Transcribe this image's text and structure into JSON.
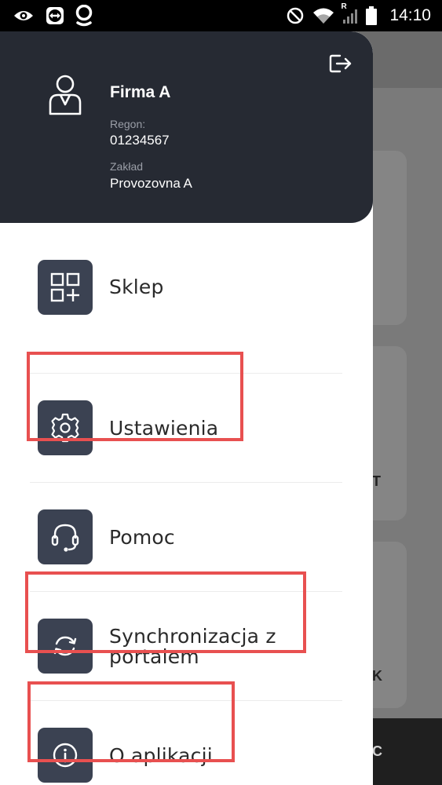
{
  "status_bar": {
    "time": "14:10",
    "left_icons": [
      "eye-icon",
      "teamviewer-icon",
      "location-pin-icon"
    ],
    "right_icons": [
      "do-not-disturb-icon",
      "wifi-icon",
      "signal-icon",
      "battery-icon"
    ],
    "roaming_indicator": "R"
  },
  "drawer": {
    "header": {
      "company_name": "Firma A",
      "regon_label": "Regon:",
      "regon_value": "01234567",
      "zaklad_label": "Zakład",
      "zaklad_value": "Provozovna A",
      "logout_icon": "logout-icon",
      "avatar_icon": "user-icon",
      "background_color": "#262a33"
    },
    "menu_items": [
      {
        "label": "Sklep",
        "icon": "grid-plus-icon",
        "highlighted": false
      },
      {
        "label": "Ustawienia",
        "icon": "gear-icon",
        "highlighted": true
      },
      {
        "label": "Pomoc",
        "icon": "headset-icon",
        "highlighted": false
      },
      {
        "label": "Synchronizacja z portalem",
        "icon": "sync-icon",
        "highlighted": true
      },
      {
        "label": "O aplikacji",
        "icon": "info-icon",
        "highlighted": true
      }
    ],
    "tile_color": "#3b4252",
    "highlight_color": "#e85050"
  },
  "background_app": {
    "visible_fragments": [
      "T",
      "K",
      "C"
    ]
  }
}
